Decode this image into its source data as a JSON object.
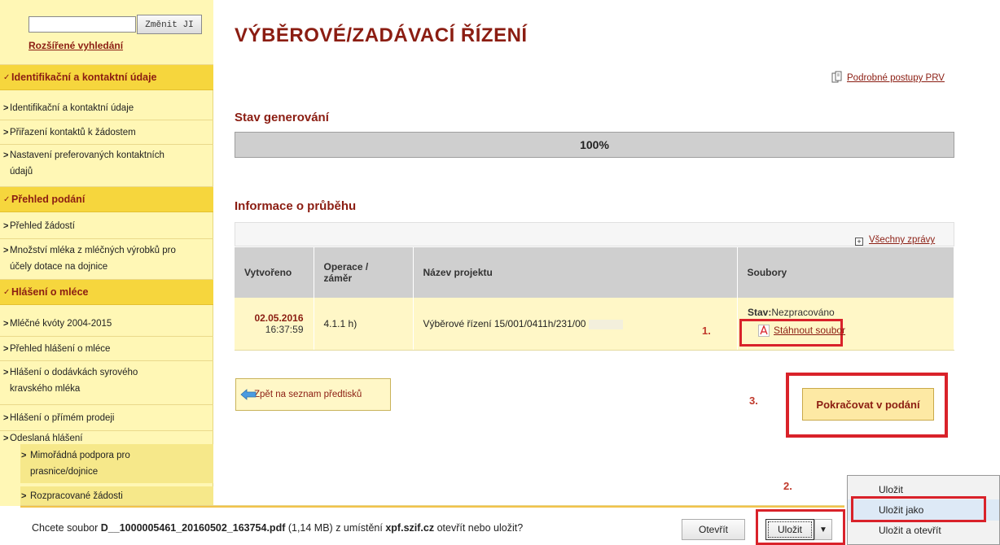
{
  "sidebar": {
    "search_button": "Změnit JI",
    "advanced_search": "Rozšířené vyhledání",
    "sections": [
      {
        "label": "Identifikační a kontaktní údaje"
      },
      {
        "label": "Přehled podání"
      },
      {
        "label": "Hlášení o mléce"
      }
    ],
    "items": [
      "Identifikační a kontaktní údaje",
      "Přiřazení kontaktů k žádostem",
      "Nastavení preferovaných kontaktních",
      "údajů",
      "Přehled žádostí",
      "Množství mléka z mléčných výrobků pro",
      "účely dotace na dojnice",
      "Mléčné kvóty 2004-2015",
      "Přehled hlášení o mléce",
      "Hlášení o dodávkách syrového",
      "kravského mléka",
      "Hlášení o přímém prodeji",
      "Odeslaná hlášení"
    ],
    "subitems": [
      "Mimořádná podpora pro",
      "prasnice/dojnice",
      "Rozpracované žádosti"
    ]
  },
  "main": {
    "title": "VÝBĚROVÉ/ZADÁVACÍ ŘÍZENÍ",
    "guide_link": "Podrobné postupy PRV",
    "generation_title": "Stav generování",
    "progress": {
      "percent": 100,
      "label": "100%"
    },
    "info_title": "Informace o průběhu",
    "all_messages": "Všechny zprávy",
    "table": {
      "headers": [
        "Vytvořeno",
        "Operace /",
        "záměr",
        "Název projektu",
        "Soubory"
      ],
      "row": {
        "date": "02.05.2016",
        "time": "16:37:59",
        "operation": "4.1.1 h)",
        "project": "Výběrové řízení 15/001/0411h/231/00",
        "status_label": "Stav:",
        "status_value": "Nezpracováno",
        "download": "Stáhnout soubor"
      }
    },
    "back_button": "Zpět na seznam předtisků",
    "continue_button": "Pokračovat v podání",
    "steps": {
      "one": "1.",
      "two": "2.",
      "three": "3."
    }
  },
  "download_bar": {
    "prefix": "Chcete soubor ",
    "filename": "D__1000005461_20160502_163754.pdf",
    "size": " (1,14 MB) z umístění ",
    "host": "xpf.szif.cz",
    "suffix": " otevřít nebo uložit?",
    "open": "Otevřít",
    "save": "Uložit",
    "dropdown": "▼"
  },
  "save_menu": [
    "Uložit",
    "Uložit jako",
    "Uložit a otevřít"
  ],
  "colors": {
    "accent": "#8b1d12",
    "highlight": "#d9222a",
    "sidebar_bg": "#fff7b5",
    "section_bg": "#f6d63d"
  }
}
